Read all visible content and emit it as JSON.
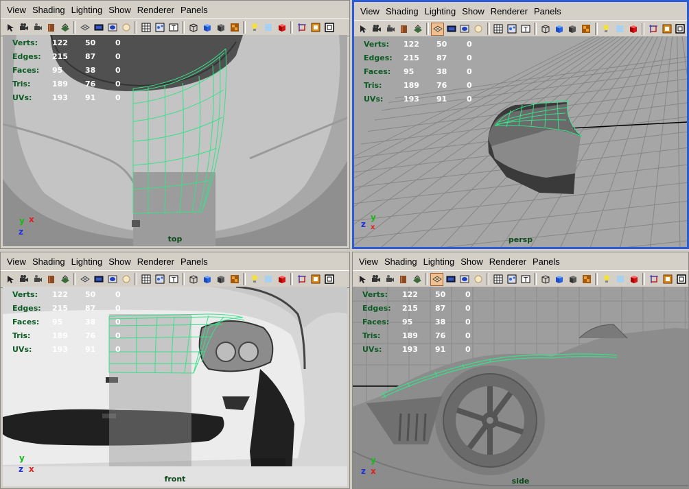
{
  "menu": [
    "View",
    "Shading",
    "Lighting",
    "Show",
    "Renderer",
    "Panels"
  ],
  "toolbar_icons": [
    "select-camera-icon",
    "camera-icon",
    "camera-attr-icon",
    "bookmark-icon",
    "image-plane-icon",
    "grid-icon",
    "film-gate-icon",
    "resolution-gate-icon",
    "safe-action-icon",
    "wireframe-icon",
    "xray-icon",
    "textured-icon",
    "wireframe-cube-icon",
    "smooth-shade-icon",
    "flat-shade-icon",
    "bounding-box-icon",
    "light-icon",
    "default-light-icon",
    "shadow-icon",
    "isolate-select-icon",
    "xray-joint-icon",
    "high-quality-icon"
  ],
  "hud": {
    "rows": [
      {
        "label": "Verts:",
        "a": "122",
        "b": "50",
        "c": "0"
      },
      {
        "label": "Edges:",
        "a": "215",
        "b": "87",
        "c": "0"
      },
      {
        "label": "Faces:",
        "a": "95",
        "b": "38",
        "c": "0"
      },
      {
        "label": "Tris:",
        "a": "189",
        "b": "76",
        "c": "0"
      },
      {
        "label": "UVs:",
        "a": "193",
        "b": "91",
        "c": "0"
      }
    ]
  },
  "viewports": {
    "top": {
      "label": "top",
      "axis": {
        "a": "y",
        "b": "x",
        "c": "z"
      }
    },
    "persp": {
      "label": "persp",
      "axis": {
        "a": "y",
        "b": "x",
        "c": "z"
      }
    },
    "front": {
      "label": "front",
      "axis": {
        "a": "y",
        "b": "z",
        "c": "x"
      }
    },
    "side": {
      "label": "side",
      "axis": {
        "a": "y",
        "b": "z",
        "c": "x"
      }
    }
  },
  "colors": {
    "wire": "#38e08a",
    "active_border": "#2b5bd9",
    "axis_x": "#e02020",
    "axis_y": "#18b818",
    "axis_z": "#2030e0"
  }
}
